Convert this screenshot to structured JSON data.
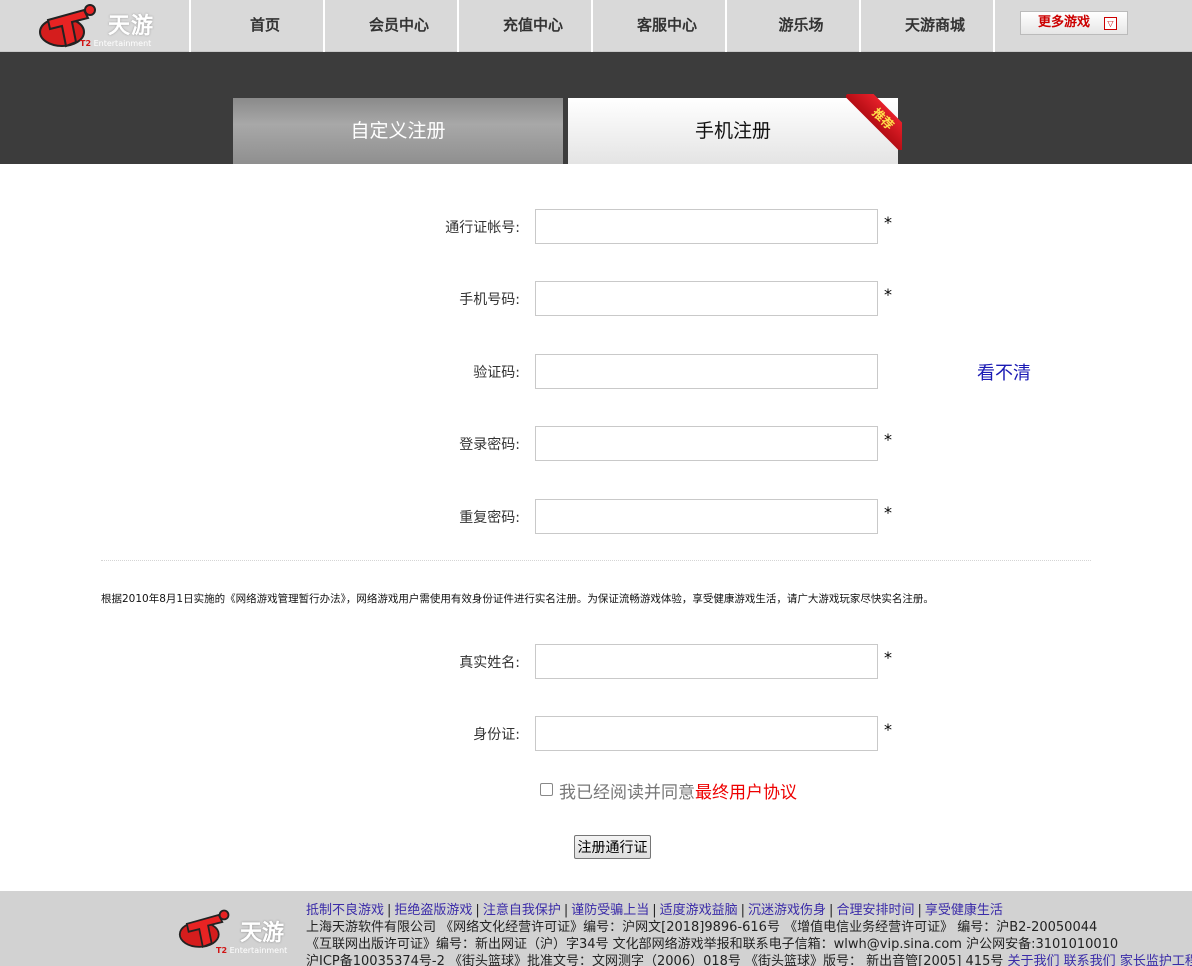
{
  "nav": {
    "logo_text": "天游",
    "logo_sub_t2": "T2",
    "logo_sub_ent": "Entertainment",
    "items": [
      "首页",
      "会员中心",
      "充值中心",
      "客服中心",
      "游乐场",
      "天游商城"
    ],
    "more_games": "更多游戏",
    "more_games_dd": "▽"
  },
  "tabs": {
    "custom": "自定义注册",
    "mobile": "手机注册",
    "ribbon": "推荐"
  },
  "form": {
    "account_label": "通行证帐号:",
    "phone_label": "手机号码:",
    "captcha_label": "验证码:",
    "captcha_link": "看不清",
    "password_label": "登录密码:",
    "repeat_label": "重复密码:",
    "required_mark": "*",
    "notice": "根据2010年8月1日实施的《网络游戏管理暂行办法》，网络游戏用户需使用有效身份证件进行实名注册。为保证流畅游戏体验，享受健康游戏生活，请广大游戏玩家尽快实名注册。",
    "realname_label": "真实姓名:",
    "idcard_label": "身份证:",
    "agree_text": "我已经阅读并同意",
    "agree_link": "最终用户协议",
    "submit": "注册通行证"
  },
  "footer": {
    "logo_text": "天游",
    "logo_sub_t2": "T2",
    "logo_sub_ent": "Entertainment",
    "health_links": [
      "抵制不良游戏",
      "拒绝盗版游戏",
      "注意自我保护",
      "谨防受骗上当",
      "适度游戏益脑",
      "沉迷游戏伤身",
      "合理安排时间",
      "享受健康生活"
    ],
    "line2": "上海天游软件有限公司 《网络文化经营许可证》编号：沪网文[2018]9896-616号 《增值电信业务经营许可证》 编号：沪B2-20050044",
    "line3": "《互联网出版许可证》编号：新出网证（沪）字34号 文化部网络游戏举报和联系电子信箱：wlwh@vip.sina.com 沪公网安备:3101010010",
    "line4": "沪ICP备10035374号-2 《街头篮球》批准文号：文网测字（2006）018号 《街头篮球》版号： 新出音管[2005] 415号",
    "about": "关于我们",
    "contact": "联系我们",
    "parent": "家长监护工程"
  },
  "colors": {
    "band": "#3c3c3c",
    "ribbon": "#d0141c",
    "agree_link": "#e00000",
    "footer_link": "#3a2ba8"
  }
}
